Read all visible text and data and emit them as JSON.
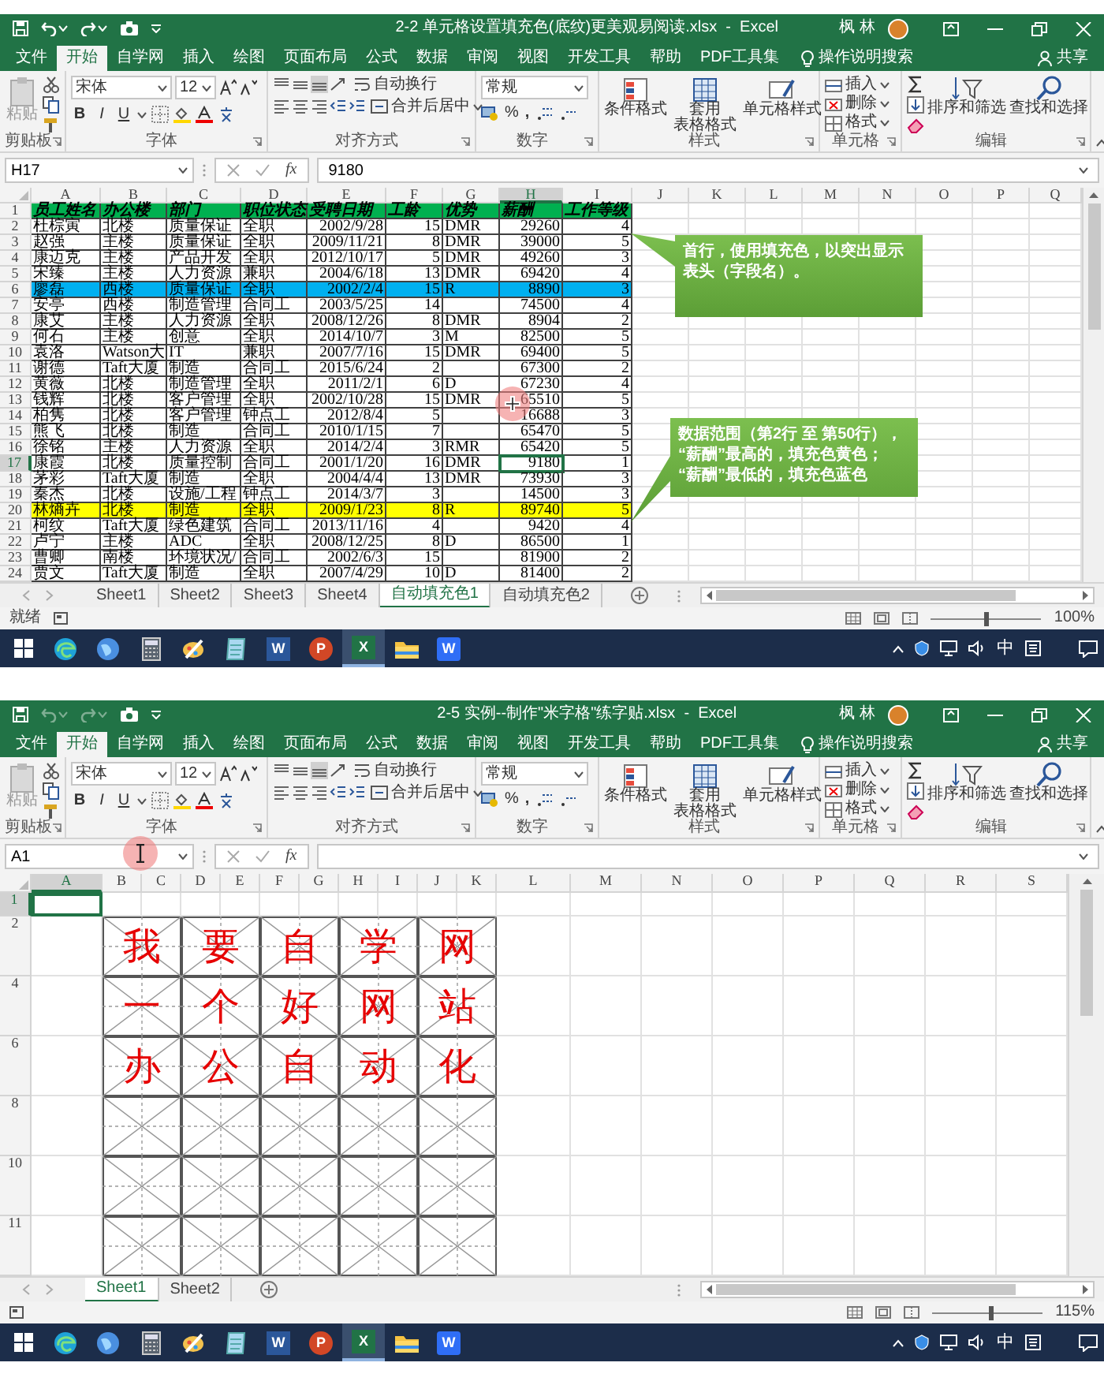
{
  "windows": [
    {
      "title": "2-2 单元格设置填充色(底纹)更美观易阅读.xlsx  -  Excel",
      "undo_enabled": true,
      "redo_enabled": true,
      "user": "枫 林",
      "tabs": [
        {
          "label": "文件",
          "selected": false
        },
        {
          "label": "开始",
          "selected": true
        },
        {
          "label": "自学网",
          "selected": false
        },
        {
          "label": "插入",
          "selected": false
        },
        {
          "label": "绘图",
          "selected": false
        },
        {
          "label": "页面布局",
          "selected": false
        },
        {
          "label": "公式",
          "selected": false
        },
        {
          "label": "数据",
          "selected": false
        },
        {
          "label": "审阅",
          "selected": false
        },
        {
          "label": "视图",
          "selected": false
        },
        {
          "label": "开发工具",
          "selected": false
        },
        {
          "label": "帮助",
          "selected": false
        },
        {
          "label": "PDF工具集",
          "selected": false
        }
      ],
      "search_hint": "操作说明搜索",
      "share": "共享",
      "ribbon": {
        "paste": "粘贴",
        "font_name": "宋体",
        "font_size": "12",
        "font_buttons": [
          "B",
          "I",
          "U"
        ],
        "wrap_text": "自动换行",
        "merge": "合并后居中",
        "number_format": "常规",
        "percent": "%",
        "comma": ",",
        "cond_format": "条件格式",
        "table_format": "套用表格格式",
        "cell_style": "单元格样式",
        "insert": "插入",
        "delete": "删除",
        "format": "格式",
        "sort": "排序和筛选",
        "find": "查找和选择",
        "groups": [
          "剪贴板",
          "字体",
          "对齐方式",
          "数字",
          "样式",
          "单元格",
          "编辑"
        ]
      },
      "name_box": "H17",
      "fx": "fx",
      "formula": "9180",
      "cursor": {
        "kind": "crosshair"
      },
      "sheet": {
        "kind": "table",
        "columns": [
          {
            "label": "A",
            "selected": false
          },
          {
            "label": "B",
            "selected": false
          },
          {
            "label": "C",
            "selected": false
          },
          {
            "label": "D",
            "selected": false
          },
          {
            "label": "E",
            "selected": false
          },
          {
            "label": "F",
            "selected": false
          },
          {
            "label": "G",
            "selected": false
          },
          {
            "label": "H",
            "selected": true
          },
          {
            "label": "I",
            "selected": false
          },
          {
            "label": "J",
            "selected": false
          },
          {
            "label": "K",
            "selected": false
          },
          {
            "label": "L",
            "selected": false
          },
          {
            "label": "M",
            "selected": false
          },
          {
            "label": "N",
            "selected": false
          },
          {
            "label": "O",
            "selected": false
          },
          {
            "label": "P",
            "selected": false
          },
          {
            "label": "Q",
            "selected": false
          }
        ],
        "rows": [
          {
            "label": "1",
            "kind": "header",
            "color": "#00b050",
            "selected": false,
            "cells": [
              "员工姓名",
              "办公楼",
              "部门",
              "职位状态",
              "受聘日期",
              "工龄",
              "优势",
              "薪酬",
              "工作等级"
            ]
          },
          {
            "label": "2",
            "kind": "data",
            "selected": false,
            "cells": [
              "杜棕寅",
              "北楼",
              "质量保证",
              "全职",
              "2002/9/28",
              "15",
              "DMR",
              "29260",
              "4"
            ]
          },
          {
            "label": "3",
            "kind": "data",
            "selected": false,
            "cells": [
              "赵强",
              "主楼",
              "质量保证",
              "全职",
              "2009/11/21",
              "8",
              "DMR",
              "39000",
              "5"
            ]
          },
          {
            "label": "4",
            "kind": "data",
            "selected": false,
            "cells": [
              "康迈克",
              "主楼",
              "产品开发",
              "全职",
              "2012/10/17",
              "5",
              "DMR",
              "49260",
              "3"
            ]
          },
          {
            "label": "5",
            "kind": "data",
            "selected": false,
            "cells": [
              "宋臻",
              "主楼",
              "人力资源",
              "兼职",
              "2004/6/18",
              "13",
              "DMR",
              "69420",
              "4"
            ]
          },
          {
            "label": "6",
            "kind": "data",
            "color": "#00b0f0",
            "selected": false,
            "cells": [
              "廖磊",
              "西楼",
              "质量保证",
              "全职",
              "2002/2/4",
              "15",
              "R",
              "8890",
              "3"
            ]
          },
          {
            "label": "7",
            "kind": "data",
            "selected": false,
            "cells": [
              "安亭",
              "西楼",
              "制造管理",
              "合同工",
              "2003/5/25",
              "14",
              null,
              "74500",
              "4"
            ]
          },
          {
            "label": "8",
            "kind": "data",
            "selected": false,
            "cells": [
              "康艾",
              "主楼",
              "人力资源",
              "全职",
              "2008/12/26",
              "8",
              "DMR",
              "8904",
              "2"
            ]
          },
          {
            "label": "9",
            "kind": "data",
            "selected": false,
            "cells": [
              "何石",
              "主楼",
              "创意",
              "全职",
              "2014/10/7",
              "3",
              "M",
              "82500",
              "5"
            ]
          },
          {
            "label": "10",
            "kind": "data",
            "selected": false,
            "cells": [
              "袁洛",
              "Watson大",
              "IT",
              "兼职",
              "2007/7/16",
              "15",
              "DMR",
              "69400",
              "5"
            ]
          },
          {
            "label": "11",
            "kind": "data",
            "selected": false,
            "cells": [
              "谢德",
              "Taft大厦",
              "制造",
              "合同工",
              "2015/6/24",
              "2",
              null,
              "67300",
              "2"
            ]
          },
          {
            "label": "12",
            "kind": "data",
            "selected": false,
            "cells": [
              "黄薇",
              "北楼",
              "制造管理",
              "全职",
              "2011/2/1",
              "6",
              "D",
              "67230",
              "4"
            ]
          },
          {
            "label": "13",
            "kind": "data",
            "selected": false,
            "cells": [
              "钱辉",
              "北楼",
              "客户管理",
              "全职",
              "2002/10/28",
              "15",
              "DMR",
              "65510",
              "5"
            ]
          },
          {
            "label": "14",
            "kind": "data",
            "selected": false,
            "cells": [
              "柏隽",
              "北楼",
              "客户管理",
              "钟点工",
              "2012/8/4",
              "5",
              null,
              "16688",
              "3"
            ]
          },
          {
            "label": "15",
            "kind": "data",
            "selected": false,
            "cells": [
              "熊飞",
              "北楼",
              "制造",
              "合同工",
              "2010/1/15",
              "7",
              null,
              "65470",
              "5"
            ]
          },
          {
            "label": "16",
            "kind": "data",
            "selected": false,
            "cells": [
              "徐铭",
              "主楼",
              "人力资源",
              "全职",
              "2014/2/4",
              "3",
              "RMR",
              "65420",
              "5"
            ]
          },
          {
            "label": "17",
            "kind": "data",
            "selected": true,
            "cells": [
              "康霞",
              "北楼",
              "质量控制",
              "合同工",
              "2001/1/20",
              "16",
              "DMR",
              "9180",
              "1"
            ]
          },
          {
            "label": "18",
            "kind": "data",
            "selected": false,
            "cells": [
              "茅彩",
              "Taft大厦",
              "制造",
              "全职",
              "2004/4/4",
              "13",
              "DMR",
              "73930",
              "3"
            ]
          },
          {
            "label": "19",
            "kind": "data",
            "selected": false,
            "cells": [
              "秦杰",
              "北楼",
              "设施/工程",
              "钟点工",
              "2014/3/7",
              "3",
              null,
              "14500",
              "3"
            ]
          },
          {
            "label": "20",
            "kind": "data",
            "color": "#ffff00",
            "selected": false,
            "cells": [
              "林熵卉",
              "北楼",
              "制造",
              "全职",
              "2009/1/23",
              "8",
              "R",
              "89740",
              "5"
            ]
          },
          {
            "label": "21",
            "kind": "data",
            "selected": false,
            "cells": [
              "柯纹",
              "Taft大厦",
              "绿色建筑",
              "合同工",
              "2013/11/16",
              "4",
              null,
              "9420",
              "4"
            ]
          },
          {
            "label": "22",
            "kind": "data",
            "selected": false,
            "cells": [
              "卢宁",
              "主楼",
              "ADC",
              "全职",
              "2008/12/25",
              "8",
              "D",
              "86500",
              "1"
            ]
          },
          {
            "label": "23",
            "kind": "data",
            "selected": false,
            "cells": [
              "曹卿",
              "南楼",
              "环境状况/",
              "合同工",
              "2002/6/3",
              "15",
              null,
              "81900",
              "2"
            ]
          },
          {
            "label": "24",
            "kind": "data",
            "selected": false,
            "cells": [
              "贾文",
              "Taft大厦",
              "制造",
              "全职",
              "2007/4/29",
              "10",
              "D",
              "81400",
              "2"
            ]
          }
        ],
        "callouts": [
          {
            "text": "首行，使用填充色，以突出显示表头（字段名）。"
          },
          {
            "text": "数据范围（第2行 至 第50行），\n“薪酬”最高的，填充色黄色；\n“薪酬”最低的，填充色蓝色"
          }
        ]
      },
      "sheet_tabs": [
        {
          "label": "Sheet1",
          "selected": false
        },
        {
          "label": "Sheet2",
          "selected": false
        },
        {
          "label": "Sheet3",
          "selected": false
        },
        {
          "label": "Sheet4",
          "selected": false
        },
        {
          "label": "自动填充色1",
          "selected": true
        },
        {
          "label": "自动填充色2",
          "selected": false
        }
      ],
      "status": "就绪",
      "zoom": "100%",
      "zoom_slider": {
        "level": 0.5
      },
      "taskbar": {
        "apps": [
          {
            "kind": "start",
            "selected": false
          },
          {
            "kind": "browser",
            "selected": false
          },
          {
            "kind": "globe",
            "selected": false
          },
          {
            "kind": "calculator",
            "selected": false
          },
          {
            "kind": "brush",
            "selected": false
          },
          {
            "kind": "notepad",
            "selected": false
          },
          {
            "kind": "doc",
            "letter": "W",
            "selected": false
          },
          {
            "kind": "slides",
            "letter": "P",
            "selected": false
          },
          {
            "kind": "sheet",
            "letter": "X",
            "selected": true
          },
          {
            "kind": "folder",
            "selected": false
          },
          {
            "kind": "writer",
            "letter": "W",
            "selected": false
          }
        ],
        "ime": "中"
      }
    },
    {
      "title": "2-5 实例--制作\"米字格\"练字贴.xlsx  -  Excel",
      "undo_enabled": false,
      "redo_enabled": false,
      "user": "枫 林",
      "tabs": [
        {
          "label": "文件",
          "selected": false
        },
        {
          "label": "开始",
          "selected": true
        },
        {
          "label": "自学网",
          "selected": false
        },
        {
          "label": "插入",
          "selected": false
        },
        {
          "label": "绘图",
          "selected": false
        },
        {
          "label": "页面布局",
          "selected": false
        },
        {
          "label": "公式",
          "selected": false
        },
        {
          "label": "数据",
          "selected": false
        },
        {
          "label": "审阅",
          "selected": false
        },
        {
          "label": "视图",
          "selected": false
        },
        {
          "label": "开发工具",
          "selected": false
        },
        {
          "label": "帮助",
          "selected": false
        },
        {
          "label": "PDF工具集",
          "selected": false
        }
      ],
      "search_hint": "操作说明搜索",
      "share": "共享",
      "ribbon": {
        "paste": "粘贴",
        "font_name": "宋体",
        "font_size": "12",
        "font_buttons": [
          "B",
          "I",
          "U"
        ],
        "wrap_text": "自动换行",
        "merge": "合并后居中",
        "number_format": "常规",
        "percent": "%",
        "comma": ",",
        "cond_format": "条件格式",
        "table_format": "套用表格格式",
        "cell_style": "单元格样式",
        "insert": "插入",
        "delete": "删除",
        "format": "格式",
        "sort": "排序和筛选",
        "find": "查找和选择",
        "groups": [
          "剪贴板",
          "字体",
          "对齐方式",
          "数字",
          "样式",
          "单元格",
          "编辑"
        ]
      },
      "name_box": "A1",
      "fx": "fx",
      "cursor": {
        "kind": "ibeam"
      },
      "sheet": {
        "kind": "practice",
        "columns": [
          {
            "label": "A",
            "selected": true
          },
          {
            "label": "B",
            "selected": false
          },
          {
            "label": "C",
            "selected": false
          },
          {
            "label": "D",
            "selected": false
          },
          {
            "label": "E",
            "selected": false
          },
          {
            "label": "F",
            "selected": false
          },
          {
            "label": "G",
            "selected": false
          },
          {
            "label": "H",
            "selected": false
          },
          {
            "label": "I",
            "selected": false
          },
          {
            "label": "J",
            "selected": false
          },
          {
            "label": "K",
            "selected": false
          },
          {
            "label": "L",
            "selected": false
          },
          {
            "label": "M",
            "selected": false
          },
          {
            "label": "N",
            "selected": false
          },
          {
            "label": "O",
            "selected": false
          },
          {
            "label": "P",
            "selected": false
          },
          {
            "label": "Q",
            "selected": false
          },
          {
            "label": "R",
            "selected": false
          },
          {
            "label": "S",
            "selected": false
          }
        ],
        "rows": [
          {
            "label": "1",
            "selected": true
          },
          {
            "label": "2",
            "selected": false
          },
          {
            "label": "4",
            "selected": false
          },
          {
            "label": "6",
            "selected": false
          },
          {
            "label": "8",
            "selected": false
          },
          {
            "label": "10",
            "selected": false
          },
          {
            "label": "11",
            "selected": false
          }
        ],
        "characters": [
          [
            "我",
            "要",
            "自",
            "学",
            "网"
          ],
          [
            "一",
            "个",
            "好",
            "网",
            "站"
          ],
          [
            "办",
            "公",
            "自",
            "动",
            "化"
          ]
        ]
      },
      "sheet_tabs": [
        {
          "label": "Sheet1",
          "selected": true
        },
        {
          "label": "Sheet2",
          "selected": false
        }
      ],
      "zoom": "115%",
      "zoom_slider": {
        "level": 0.53
      },
      "taskbar": {
        "apps": [
          {
            "kind": "start",
            "selected": false
          },
          {
            "kind": "browser",
            "selected": false
          },
          {
            "kind": "globe",
            "selected": false
          },
          {
            "kind": "calculator",
            "selected": false
          },
          {
            "kind": "brush",
            "selected": false
          },
          {
            "kind": "notepad",
            "selected": false
          },
          {
            "kind": "doc",
            "letter": "W",
            "selected": false
          },
          {
            "kind": "slides",
            "letter": "P",
            "selected": false
          },
          {
            "kind": "sheet",
            "letter": "X",
            "selected": true
          },
          {
            "kind": "folder",
            "selected": false
          },
          {
            "kind": "writer",
            "letter": "W",
            "selected": false
          }
        ],
        "ime": "中"
      }
    }
  ]
}
